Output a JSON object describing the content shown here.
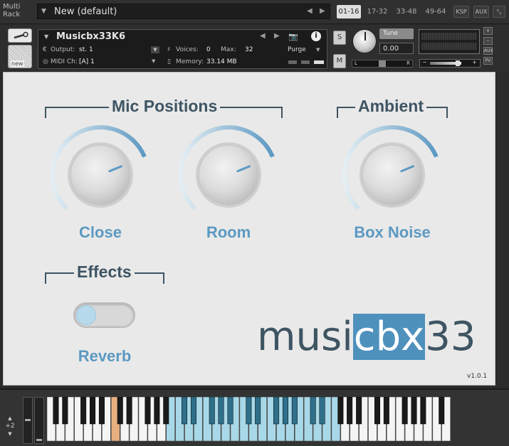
{
  "rack": {
    "label": "Multi Rack",
    "preset": "New (default)",
    "ranges": [
      "01-16",
      "17-32",
      "33-48",
      "49-64"
    ],
    "tools": [
      "KSP",
      "AUX"
    ]
  },
  "instrument": {
    "name": "Musicbx33K6",
    "output_label": "Output:",
    "output_value": "st. 1",
    "voices_label": "Voices:",
    "voices_value": "0",
    "max_label": "Max:",
    "max_value": "32",
    "midi_label": "MIDI Ch:",
    "midi_value": "[A]  1",
    "memory_label": "Memory:",
    "memory_value": "33.14 MB",
    "purge_label": "Purge",
    "solo_label": "S",
    "mute_label": "M",
    "tune_label": "Tune",
    "tune_value": "0.00",
    "pan_left": "L",
    "pan_right": "R",
    "new_label": "new"
  },
  "panel": {
    "mic_title": "Mic Positions",
    "ambient_title": "Ambient",
    "effects_title": "Effects",
    "knobs": [
      {
        "label": "Close",
        "level": 0.75
      },
      {
        "label": "Room",
        "level": 0.75
      },
      {
        "label": "Box Noise",
        "level": 0.75
      }
    ],
    "reverb_label": "Reverb",
    "reverb_on": false,
    "logo_part1": "musi",
    "logo_part2": "cbx",
    "logo_part3": "33",
    "version": "v1.0.1"
  },
  "keyboard": {
    "octave": "+2"
  },
  "colors": {
    "accent": "#5c99c2",
    "dark": "#3e5563",
    "keyrange": "#a8d8e8",
    "keyswitch": "#e8b080"
  }
}
